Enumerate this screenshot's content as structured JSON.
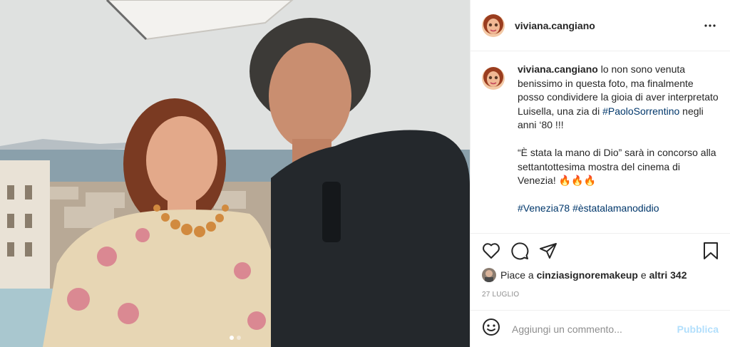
{
  "post": {
    "username": "viviana.cangiano",
    "caption": {
      "line1": "lo non sono venuta benissimo in questa foto, ma finalmente posso condividere la gioia di aver interpretato Luisella, una zia di ",
      "hashtag1": "#PaoloSorrentino",
      "line1_end": " negli anni ‘80 !!!",
      "line2": "“È stata la mano di Dio” sarà in concorso alla settantottesima mostra del cinema di Venezia! 🔥🔥🔥",
      "hashtag2": "#Venezia78",
      "hashtag3": "#èstatalamanodidio"
    },
    "likes": {
      "prefix": "Piace a",
      "user": "cinziasignoremakeup",
      "middle": "e",
      "others": "altri 342"
    },
    "date": "27 LUGLIO",
    "comment_placeholder": "Aggiungi un commento...",
    "publish_label": "Pubblica",
    "carousel": {
      "count": 2,
      "active": 0
    }
  },
  "icons": {
    "more": "more-options-icon",
    "like": "heart-icon",
    "comment": "comment-icon",
    "share": "share-icon",
    "save": "bookmark-icon",
    "emoji": "emoji-icon"
  },
  "colors": {
    "hashtag": "#00376b",
    "publish_disabled": "#b2dffc",
    "muted": "#8e8e8e",
    "border": "#efefef"
  }
}
